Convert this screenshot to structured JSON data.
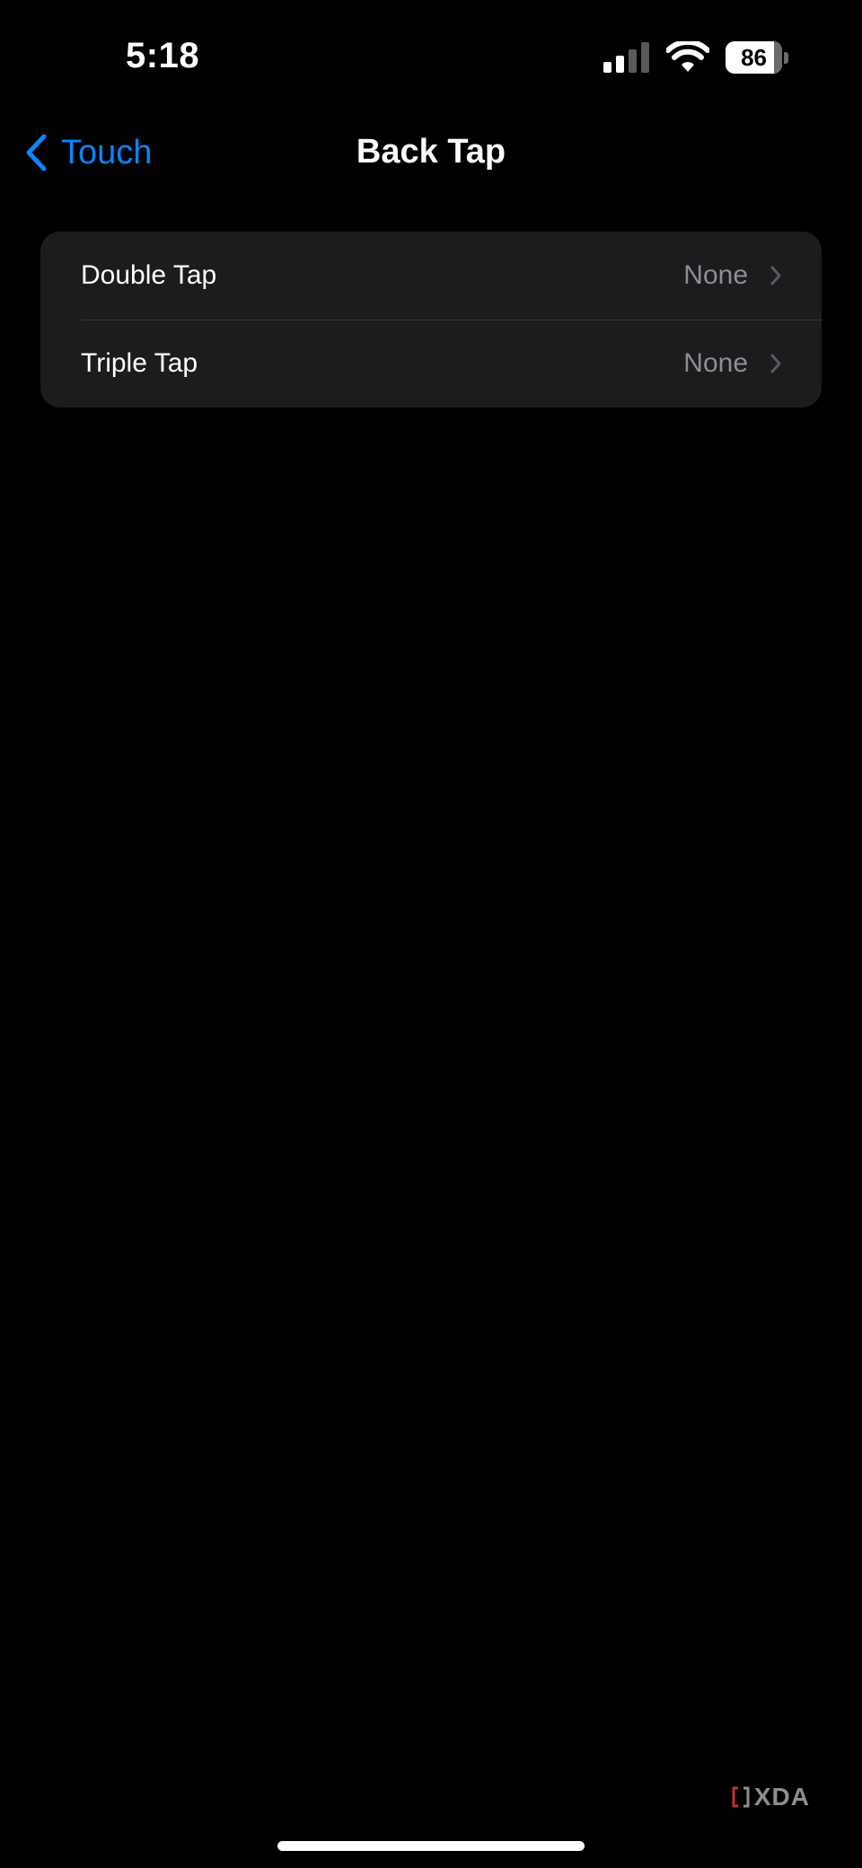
{
  "status_bar": {
    "time": "5:18",
    "battery_level": "86",
    "battery_fraction": 0.86,
    "signal_bars_active": 2,
    "signal_bars_total": 4
  },
  "nav": {
    "back_label": "Touch",
    "title": "Back Tap"
  },
  "settings": {
    "rows": [
      {
        "label": "Double Tap",
        "value": "None"
      },
      {
        "label": "Triple Tap",
        "value": "None"
      }
    ]
  },
  "watermark": {
    "text": "XDA"
  },
  "icons": {
    "signal": "cellular-signal-icon",
    "wifi": "wifi-icon",
    "battery": "battery-icon",
    "back": "chevron-left-icon",
    "row_disclosure": "chevron-right-icon",
    "watermark_logo": "xda-mark-icon"
  },
  "colors": {
    "background": "#000000",
    "group_background": "#1c1c1e",
    "accent": "#0a84ff",
    "secondary_text": "#8e8e93",
    "separator": "#38383a"
  }
}
